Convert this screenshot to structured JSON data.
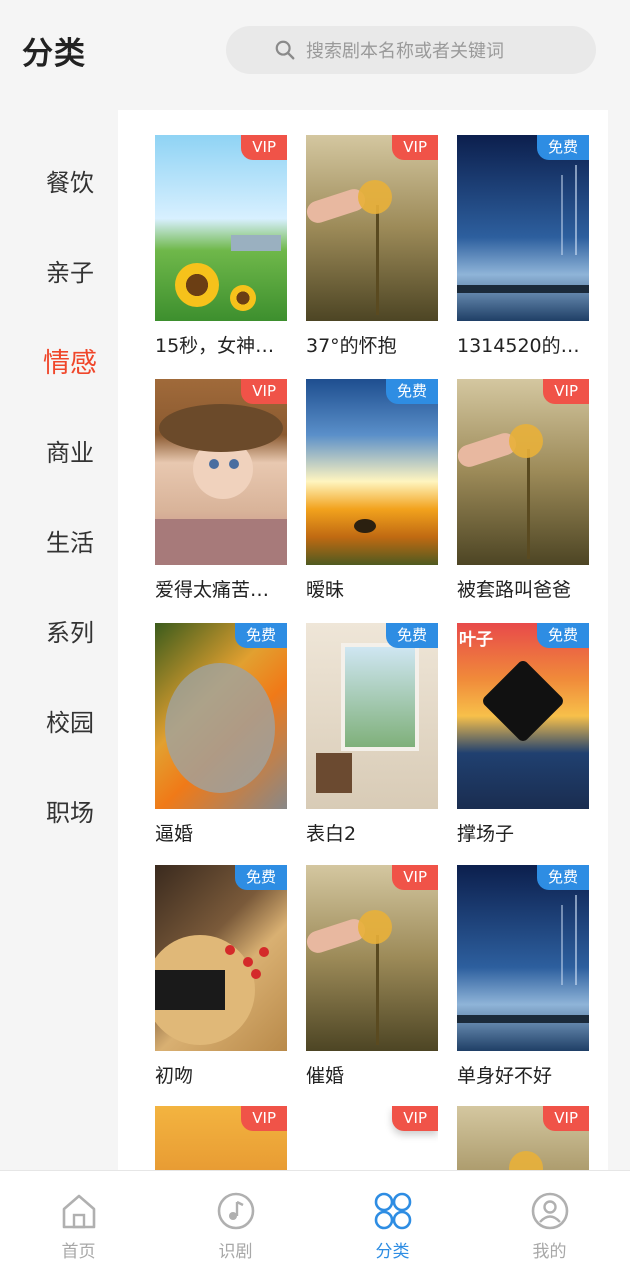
{
  "header": {
    "title": "分类",
    "search_placeholder": "搜索剧本名称或者关键词"
  },
  "categories": [
    {
      "label": "餐饮",
      "active": false
    },
    {
      "label": "亲子",
      "active": false
    },
    {
      "label": "情感",
      "active": true
    },
    {
      "label": "商业",
      "active": false
    },
    {
      "label": "生活",
      "active": false
    },
    {
      "label": "系列",
      "active": false
    },
    {
      "label": "校园",
      "active": false
    },
    {
      "label": "职场",
      "active": false
    }
  ],
  "items": [
    {
      "title": "15秒，女神…",
      "badge": "VIP"
    },
    {
      "title": "37°的怀抱",
      "badge": "VIP"
    },
    {
      "title": "1314520的…",
      "badge": "免费"
    },
    {
      "title": "爱得太痛苦…",
      "badge": "VIP"
    },
    {
      "title": "暧昧",
      "badge": "免费"
    },
    {
      "title": "被套路叫爸爸",
      "badge": "VIP"
    },
    {
      "title": "逼婚",
      "badge": "免费"
    },
    {
      "title": "表白2",
      "badge": "免费"
    },
    {
      "title": "撑场子",
      "badge": "免费"
    },
    {
      "title": "初吻",
      "badge": "免费"
    },
    {
      "title": "催婚",
      "badge": "VIP"
    },
    {
      "title": "单身好不好",
      "badge": "免费"
    },
    {
      "title": "",
      "badge": "VIP"
    },
    {
      "title": "",
      "badge": "VIP"
    },
    {
      "title": "",
      "badge": "VIP"
    }
  ],
  "thumb_text": {
    "maple": "叶子"
  },
  "tabbar": [
    {
      "label": "首页",
      "icon": "home-icon",
      "active": false
    },
    {
      "label": "识剧",
      "icon": "music-note-icon",
      "active": false
    },
    {
      "label": "分类",
      "icon": "category-grid-icon",
      "active": true
    },
    {
      "label": "我的",
      "icon": "profile-icon",
      "active": false
    }
  ],
  "colors": {
    "accent_red": "#f0462a",
    "vip_badge": "#f05348",
    "free_badge": "#2e8de3",
    "tab_active": "#2e8de3"
  }
}
